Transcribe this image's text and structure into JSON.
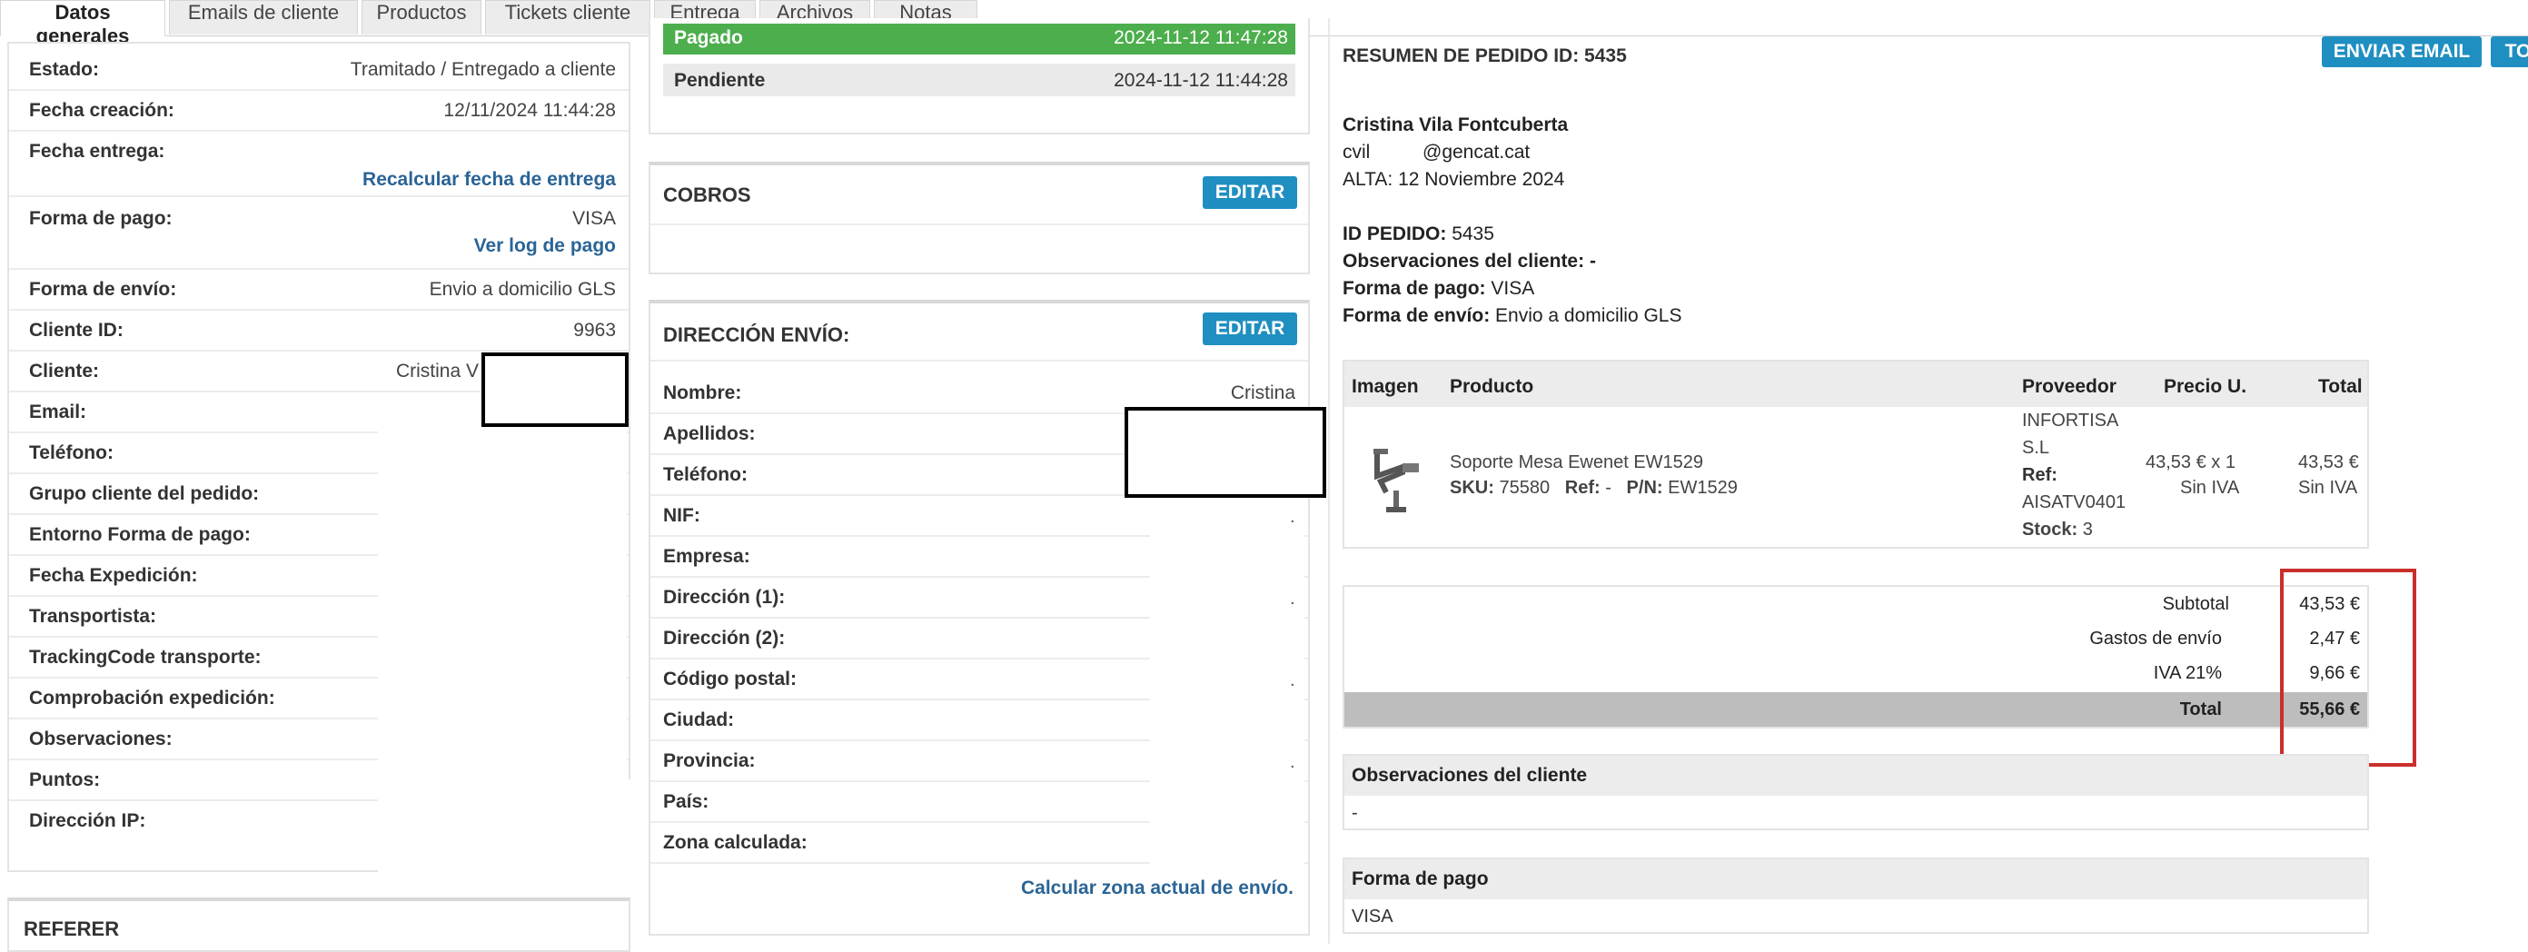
{
  "tabs": [
    {
      "label": "Datos generales"
    },
    {
      "label": "Emails de cliente"
    },
    {
      "label": "Productos"
    },
    {
      "label": "Tickets cliente"
    },
    {
      "label": "Entrega"
    },
    {
      "label": "Archivos"
    },
    {
      "label": "Notas"
    }
  ],
  "left": {
    "rows": [
      {
        "label": "Estado:",
        "value": "Tramitado / Entregado a cliente"
      },
      {
        "label": "Fecha creación:",
        "value": "12/11/2024 11:44:28"
      },
      {
        "label": "Fecha entrega:",
        "value": ""
      },
      {
        "label": "Forma de pago:",
        "value": "VISA"
      },
      {
        "label": "Forma de envío:",
        "value": "Envio a domicilio GLS"
      },
      {
        "label": "Cliente ID:",
        "value": "9963"
      },
      {
        "label": "Cliente:",
        "value": "Cristina V"
      },
      {
        "label": "Email:",
        "value": ""
      },
      {
        "label": "Teléfono:",
        "value": ""
      },
      {
        "label": "Grupo cliente del pedido:",
        "value": ""
      },
      {
        "label": "Entorno Forma de pago:",
        "value": ""
      },
      {
        "label": "Fecha Expedición:",
        "value": ""
      },
      {
        "label": "Transportista:",
        "value": ""
      },
      {
        "label": "TrackingCode transporte:",
        "value": ""
      },
      {
        "label": "Comprobación expedición:",
        "value": ""
      },
      {
        "label": "Observaciones:",
        "value": ""
      },
      {
        "label": "Puntos:",
        "value": ""
      },
      {
        "label": "Dirección IP:",
        "value": ""
      }
    ],
    "recalc_link": "Recalcular fecha de entrega",
    "log_link": "Ver log de pago",
    "referer_title": "REFERER"
  },
  "middle": {
    "history": [
      {
        "label": "Pagado",
        "date": "2024-11-12 11:47:28"
      },
      {
        "label": "Pendiente",
        "date": "2024-11-12 11:44:28"
      }
    ],
    "cobros_title": "COBROS",
    "edit_label": "EDITAR",
    "dir_title": "DIRECCIÓN ENVÍO:",
    "dir_rows": [
      {
        "label": "Nombre:",
        "value": "Cristina"
      },
      {
        "label": "Apellidos:",
        "value": ""
      },
      {
        "label": "Teléfono:",
        "value": ""
      },
      {
        "label": "NIF:",
        "value": ""
      },
      {
        "label": "Empresa:",
        "value": ""
      },
      {
        "label": "Dirección (1):",
        "value": ""
      },
      {
        "label": "Dirección (2):",
        "value": ""
      },
      {
        "label": "Código postal:",
        "value": ""
      },
      {
        "label": "Ciudad:",
        "value": ""
      },
      {
        "label": "Provincia:",
        "value": ""
      },
      {
        "label": "País:",
        "value": ""
      },
      {
        "label": "Zona calculada:",
        "value": ""
      }
    ],
    "calc_link": "Calcular zona actual de envío."
  },
  "right": {
    "title": "RESUMEN DE PEDIDO ID: 5435",
    "email_btn": "ENVIAR EMAIL",
    "to_btn": "TO",
    "customer_name": "Cristina  Vila Fontcuberta",
    "email_prefix": "cvil",
    "email_domain": "@gencat.cat",
    "alta": "ALTA: 12 Noviembre 2024",
    "id_label": "ID PEDIDO:",
    "id_value": "5435",
    "obs_label": "Observaciones del cliente:",
    "obs_value": "-",
    "pago_label": "Forma de pago:",
    "pago_value": "VISA",
    "envio_label": "Forma de envío:",
    "envio_value": "Envio a domicilio GLS",
    "table_headers": {
      "imagen": "Imagen",
      "producto": "Producto",
      "proveedor": "Proveedor",
      "precio": "Precio U.",
      "total": "Total"
    },
    "product": {
      "name": "Soporte Mesa Ewenet EW1529",
      "sku_label": "SKU:",
      "sku": "75580",
      "ref_label": "Ref:",
      "ref": "-",
      "pn_label": "P/N:",
      "pn": "EW1529",
      "prov_line1": "INFORTISA",
      "prov_line2": "S.L",
      "prov_ref_label": "Ref:",
      "prov_ref": "AISATV0401",
      "stock_label": "Stock:",
      "stock": "3",
      "price": "43,53 €  x 1",
      "price_note": "Sin IVA",
      "total": "43,53 €",
      "total_note": "Sin IVA"
    },
    "totals": [
      {
        "label": "Subtotal",
        "value": "43,53 €"
      },
      {
        "label": "Gastos de envío",
        "value": "2,47 €"
      },
      {
        "label": "IVA 21%",
        "value": "9,66 €"
      },
      {
        "label": "Total",
        "value": "55,66 €"
      }
    ],
    "obs_box_title": "Observaciones del cliente",
    "obs_box_value": "-",
    "pago_box_title": "Forma de pago",
    "pago_box_value": "VISA"
  },
  "colors": {
    "accent": "#1f8fc1",
    "paid": "#4cae4c",
    "highlight": "#c9302c",
    "total_row": "#bdbdbd"
  }
}
